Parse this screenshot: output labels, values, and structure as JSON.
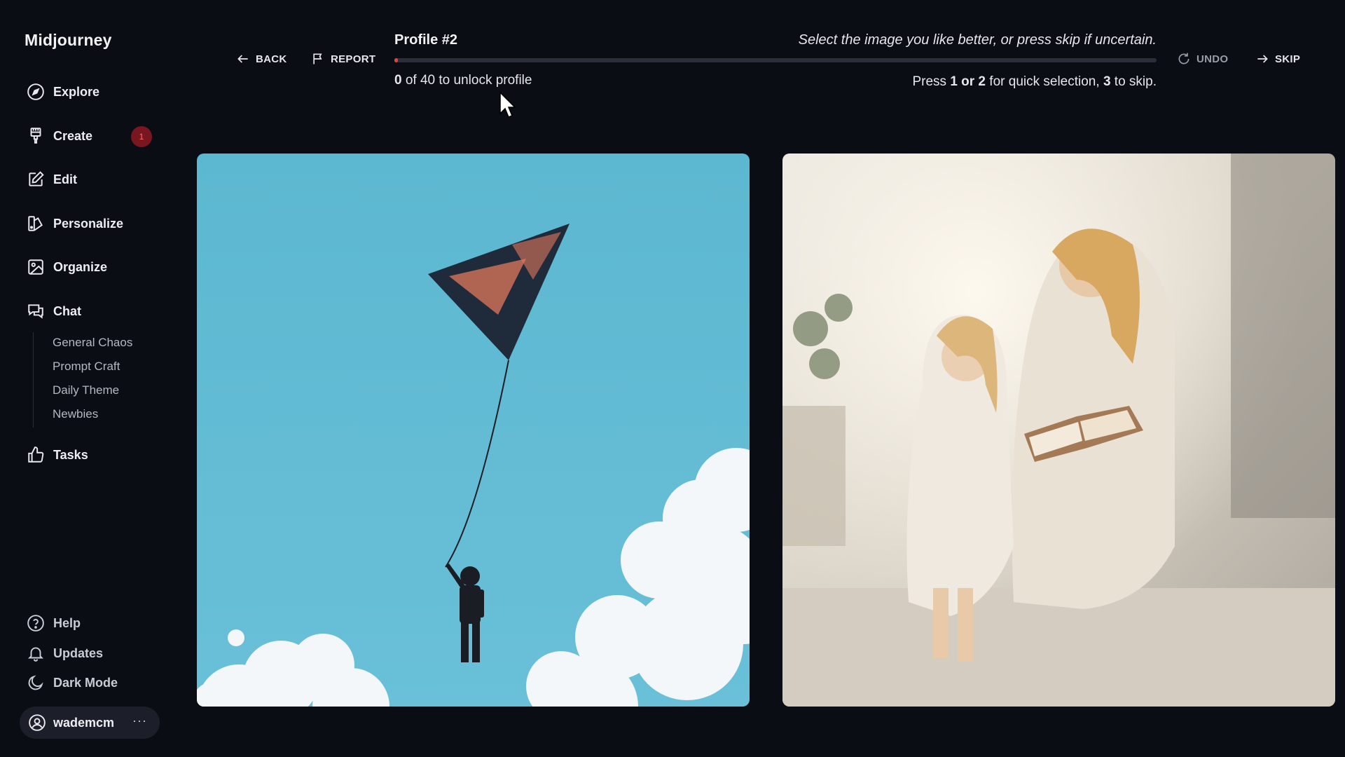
{
  "app": {
    "title": "Midjourney"
  },
  "sidebar": {
    "items": [
      {
        "label": "Explore",
        "icon": "compass-icon"
      },
      {
        "label": "Create",
        "icon": "brush-icon",
        "badge": "1"
      },
      {
        "label": "Edit",
        "icon": "edit-icon"
      },
      {
        "label": "Personalize",
        "icon": "personalize-icon"
      },
      {
        "label": "Organize",
        "icon": "image-icon"
      },
      {
        "label": "Chat",
        "icon": "chat-icon"
      }
    ],
    "chat_rooms": [
      "General Chaos",
      "Prompt Craft",
      "Daily Theme",
      "Newbies"
    ],
    "tasks": {
      "label": "Tasks",
      "icon": "thumbs-up-icon"
    },
    "bottom": [
      {
        "label": "Help",
        "icon": "help-icon"
      },
      {
        "label": "Updates",
        "icon": "bell-icon"
      },
      {
        "label": "Dark Mode",
        "icon": "moon-icon"
      }
    ],
    "user": {
      "name": "wademcm",
      "more": "···"
    }
  },
  "toolbar": {
    "back_label": "BACK",
    "report_label": "REPORT",
    "undo_label": "UNDO",
    "skip_label": "SKIP"
  },
  "ranking": {
    "profile_title": "Profile #2",
    "instruction": "Select the image you like better, or press skip if uncertain.",
    "progress_count": "0",
    "progress_rest": " of 40 to unlock profile",
    "progress_fraction": 0.005,
    "hint_prefix": "Press ",
    "hint_keys": "1 or 2",
    "hint_middle": " for quick selection, ",
    "hint_skip_key": "3",
    "hint_suffix": " to skip."
  },
  "images": [
    {
      "name": "kite-boy-image"
    },
    {
      "name": "mother-daughter-reading-image"
    }
  ],
  "colors": {
    "background": "#0b0d14",
    "progress_fill": "#e0463a",
    "badge_bg": "#7a1620",
    "sky": "#5cb7d0"
  }
}
